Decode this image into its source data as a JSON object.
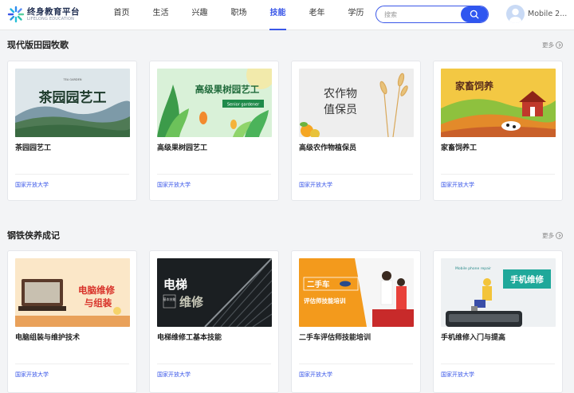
{
  "header": {
    "logo_title": "终身教育平台",
    "logo_subtitle": "LIFELONG EDUCATION",
    "nav": [
      {
        "label": "首页",
        "active": false
      },
      {
        "label": "生活",
        "active": false
      },
      {
        "label": "兴趣",
        "active": false
      },
      {
        "label": "职场",
        "active": false
      },
      {
        "label": "技能",
        "active": true
      },
      {
        "label": "老年",
        "active": false
      },
      {
        "label": "学历",
        "active": false
      }
    ],
    "search_placeholder": "搜索",
    "user_name": "Mobile 2..."
  },
  "sections": [
    {
      "title": "现代版田园牧歌",
      "more_label": "更多",
      "cards": [
        {
          "title": "茶园园艺工",
          "source": "国家开放大学",
          "image_text": "茶园园艺工",
          "image_caption": "TEA GARDEN"
        },
        {
          "title": "高级果树园艺工",
          "source": "国家开放大学",
          "image_text": "高级果树园艺工",
          "image_caption": "Senior gardener"
        },
        {
          "title": "高级农作物植保员",
          "source": "国家开放大学",
          "image_text": "农作物",
          "image_text2": "值保员"
        },
        {
          "title": "家畜饲养工",
          "source": "国家开放大学",
          "image_text": "家畜饲养"
        }
      ]
    },
    {
      "title": "钢铁侠养成记",
      "more_label": "更多",
      "cards": [
        {
          "title": "电脑组装与维护技术",
          "source": "国家开放大学",
          "image_text": "电脑维修",
          "image_text2": "与组装"
        },
        {
          "title": "电梯维修工基本技能",
          "source": "国家开放大学",
          "image_text": "电梯",
          "image_text2": "维修",
          "image_caption": "基本技能"
        },
        {
          "title": "二手车评估师技能培训",
          "source": "国家开放大学",
          "image_text": "二手车",
          "image_text2": "评估师技能培训"
        },
        {
          "title": "手机维修入门与提高",
          "source": "国家开放大学",
          "image_text": "手机维修",
          "image_caption": "Mobile phone repair"
        }
      ]
    }
  ],
  "colors": {
    "accent": "#3a57e8",
    "search_button": "#2f56f0",
    "background": "#f3f4f6"
  },
  "icons": [
    "logo-mark-icon",
    "search-icon",
    "avatar-icon",
    "more-arrow-icon"
  ]
}
